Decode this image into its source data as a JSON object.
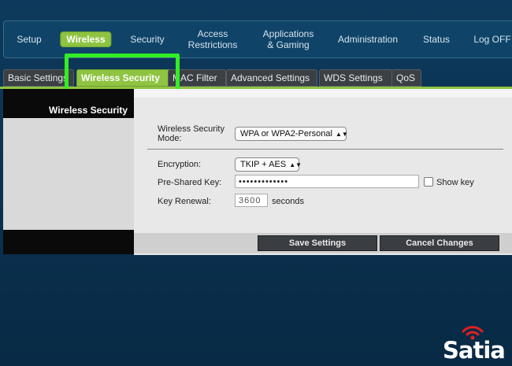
{
  "nav": {
    "items": [
      {
        "label": "Setup"
      },
      {
        "label": "Wireless",
        "active": true
      },
      {
        "label": "Security"
      },
      {
        "label": "Access\nRestrictions"
      },
      {
        "label": "Applications\n& Gaming"
      },
      {
        "label": "Administration"
      },
      {
        "label": "Status"
      },
      {
        "label": "Log OFF"
      }
    ],
    "accent_color": "#8fc442"
  },
  "tabs": [
    {
      "label": "Basic Settings"
    },
    {
      "label": "Wireless Security",
      "active": true
    },
    {
      "label": "MAC Filter"
    },
    {
      "label": "Advanced Settings"
    },
    {
      "label": "WDS Settings"
    },
    {
      "label": "QoS"
    }
  ],
  "sidebar": {
    "title": "Wireless Security"
  },
  "form": {
    "mode_label": "Wireless Security\nMode:",
    "mode_value": "WPA or WPA2-Personal",
    "encryption_label": "Encryption:",
    "encryption_value": "TKIP + AES",
    "psk_label": "Pre-Shared Key:",
    "psk_value": "•••••••••••••",
    "show_key_label": "Show key",
    "renewal_label": "Key Renewal:",
    "renewal_value": "3600",
    "renewal_unit": "seconds"
  },
  "buttons": {
    "save": "Save Settings",
    "cancel": "Cancel Changes"
  },
  "watermark": {
    "brand": "Satia",
    "icon": "wifi-icon",
    "icon_color": "#e02020"
  },
  "highlight_color": "#33ee22"
}
